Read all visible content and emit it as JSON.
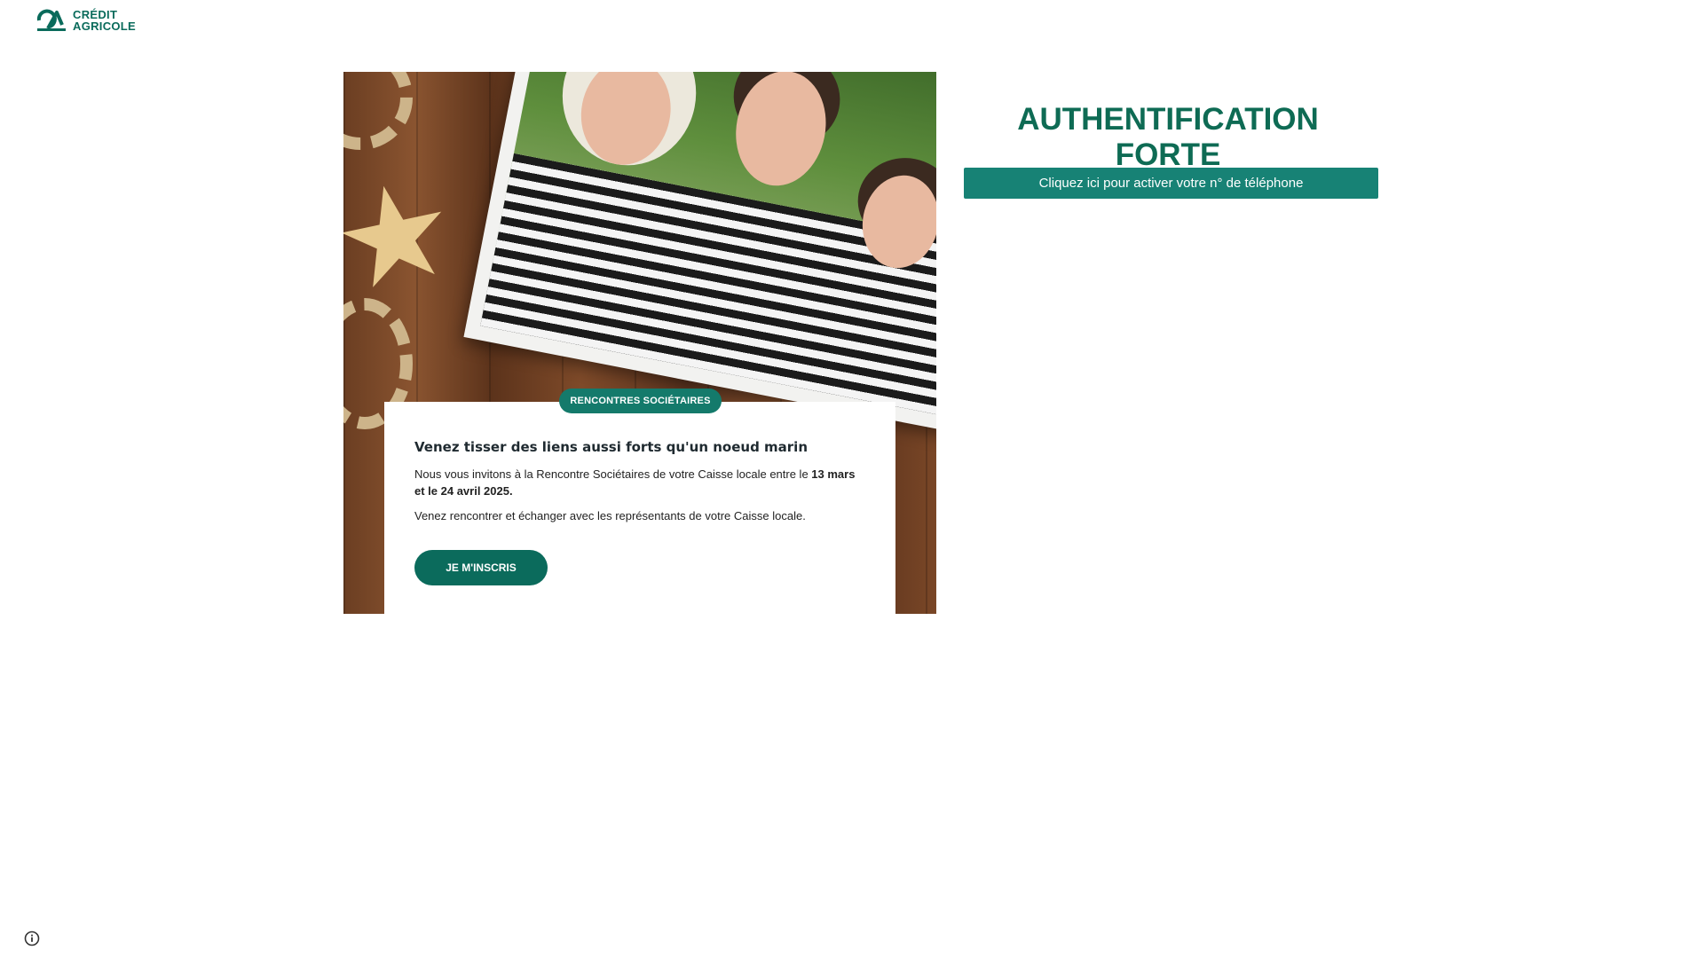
{
  "header": {
    "logo": {
      "text_line1": "CRÉDIT",
      "text_line2": "AGRICOLE",
      "icon": "ca-logo-icon"
    }
  },
  "promo": {
    "badge": "RENCONTRES SOCIÉTAIRES",
    "title": "Venez tisser des liens aussi forts qu'un noeud marin",
    "text1_before": "Nous vous invitons à la Rencontre Sociétaires de votre Caisse locale entre le ",
    "text1_bold": "13 mars et le 24 avril 2025.",
    "text2": "Venez rencontrer et échanger avec les représentants de votre Caisse locale.",
    "cta_label": "JE M'INSCRIS"
  },
  "auth": {
    "title": "AUTHENTIFICATION FORTE",
    "button_label": "Cliquez ici pour activer votre n° de téléphone"
  },
  "footer": {
    "info_icon": "info-icon"
  },
  "colors": {
    "brand_green": "#0e6b54",
    "button_teal": "#178275",
    "badge_teal": "#147a6b"
  }
}
